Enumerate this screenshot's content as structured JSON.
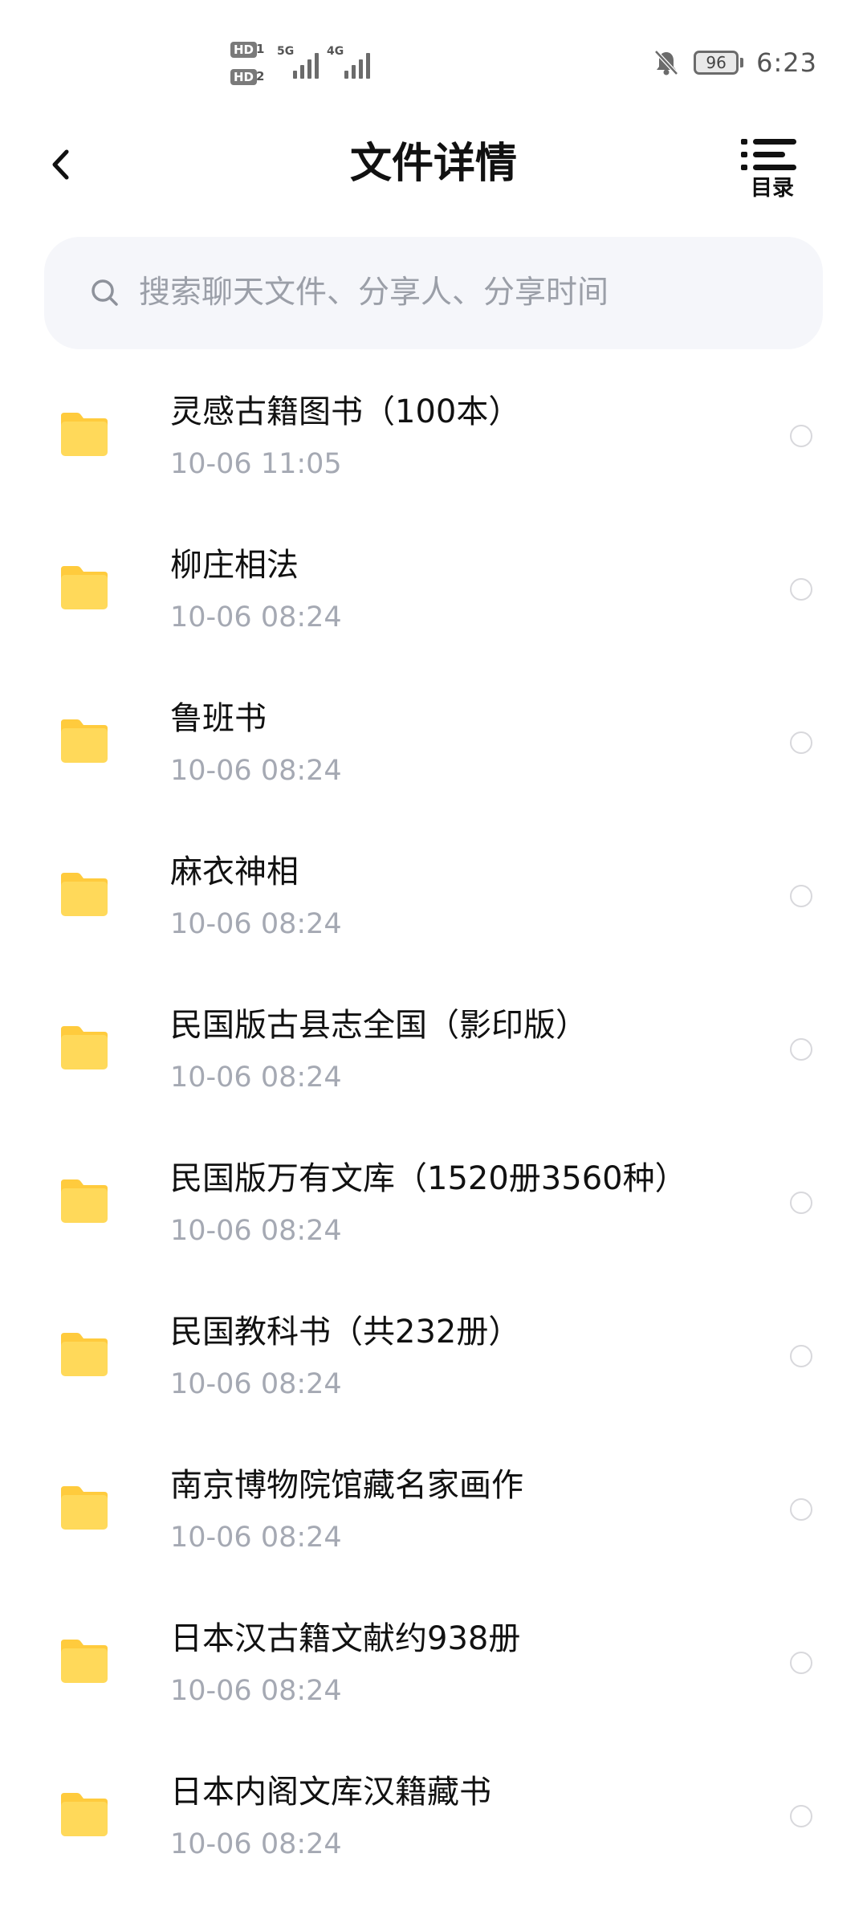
{
  "status_bar": {
    "sim1_tag": "HD",
    "sim1_num": "1",
    "sim2_tag": "HD",
    "sim2_num": "2",
    "network1": "5G",
    "network2": "4G",
    "battery": "96",
    "time": "6:23",
    "icons": [
      "notifications-muted-icon",
      "battery-icon",
      "signal-icon"
    ]
  },
  "header": {
    "title": "文件详情",
    "toc_label": "目录",
    "icons": [
      "back-arrow-icon",
      "toc-list-icon"
    ]
  },
  "search": {
    "placeholder": "搜索聊天文件、分享人、分享时间",
    "icon": "search-icon"
  },
  "colors": {
    "folder": "#FFD95A",
    "folder_tab": "#FFCB3D",
    "secondary_text": "#A5A9B3",
    "search_bg": "#F5F6FA"
  },
  "files": [
    {
      "name": "灵感古籍图书（100本）",
      "time": "10-06  11:05"
    },
    {
      "name": "柳庄相法",
      "time": "10-06  08:24"
    },
    {
      "name": "鲁班书",
      "time": "10-06  08:24"
    },
    {
      "name": "麻衣神相",
      "time": "10-06  08:24"
    },
    {
      "name": "民国版古县志全国（影印版）",
      "time": "10-06  08:24"
    },
    {
      "name": "民国版万有文库（1520册3560种）",
      "time": "10-06  08:24"
    },
    {
      "name": "民国教科书（共232册）",
      "time": "10-06  08:24"
    },
    {
      "name": "南京博物院馆藏名家画作",
      "time": "10-06  08:24"
    },
    {
      "name": "日本汉古籍文献约938册",
      "time": "10-06  08:24"
    },
    {
      "name": "日本内阁文库汉籍藏书",
      "time": "10-06  08:24"
    }
  ]
}
